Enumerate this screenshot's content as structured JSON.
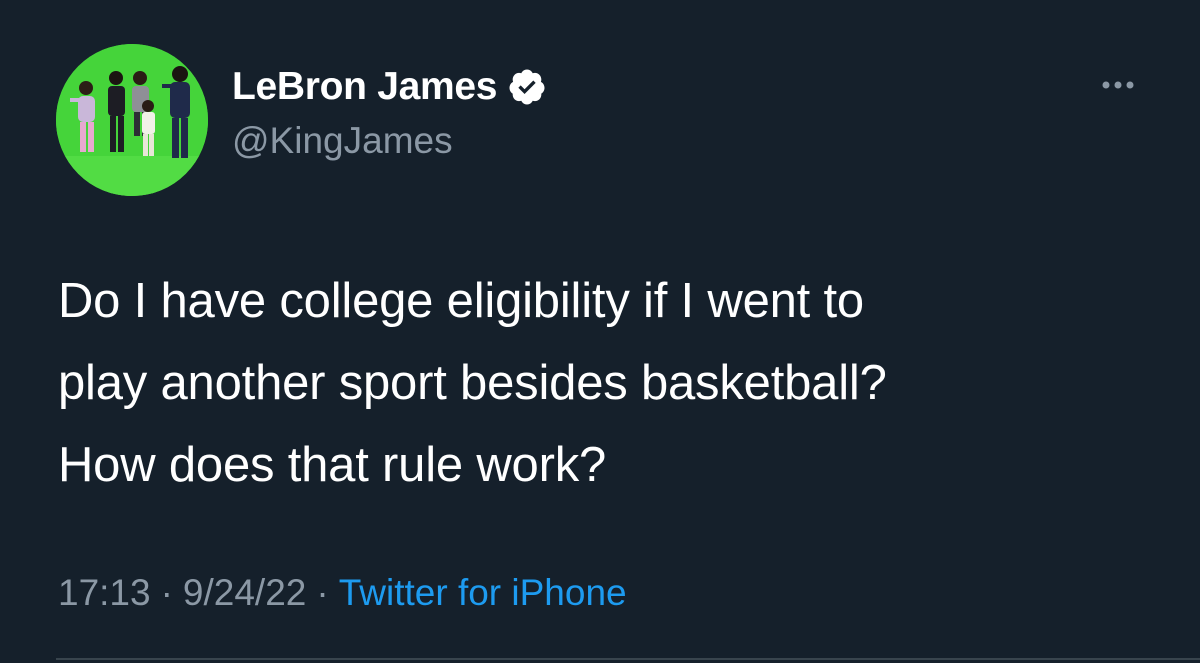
{
  "tweet": {
    "author": {
      "display_name": "LeBron James",
      "handle": "@KingJames",
      "verified": true,
      "avatar_icon": "profile-photo-green-screen"
    },
    "text_lines": [
      "Do I have college eligibility if I went to",
      "play another sport besides basketball?",
      "How does that rule work?"
    ],
    "time": "17:13",
    "date": "9/24/22",
    "separator": "·",
    "source": "Twitter for iPhone",
    "more_icon": "more-options-icon"
  },
  "colors": {
    "background": "#15202b",
    "primary_text": "#ffffff",
    "secondary_text": "#8b98a5",
    "link": "#1d9bf0",
    "avatar_bg": "#45d43a"
  }
}
